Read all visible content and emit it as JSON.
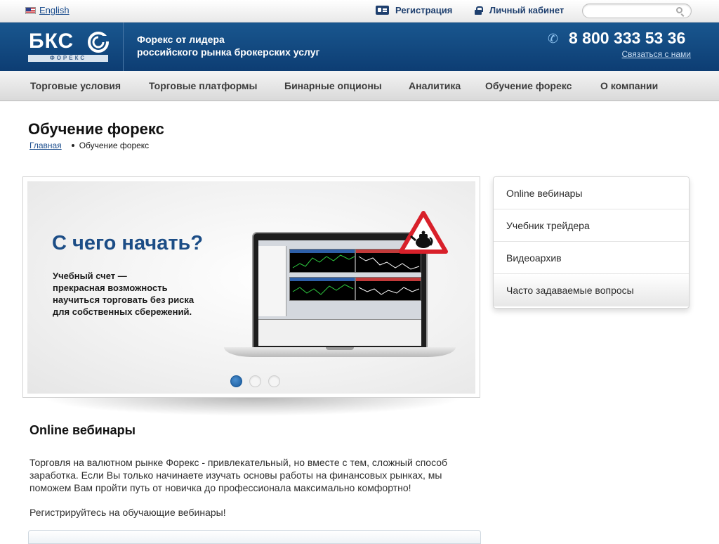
{
  "topbar": {
    "language": "English",
    "register": "Регистрация",
    "cabinet": "Личный кабинет",
    "search_placeholder": ""
  },
  "header": {
    "logo_text": "БКС",
    "logo_sub": "ФОРЕКС",
    "tagline_line1": "Форекс от лидера",
    "tagline_line2": "российского рынка брокерских услуг",
    "phone": "8 800 333 53 36",
    "contact": "Связаться с нами",
    "brand_color": "#0f4179"
  },
  "nav": {
    "items": [
      "Торговые условия",
      "Торговые платформы",
      "Бинарные опционы",
      "Аналитика",
      "Обучение форекс",
      "О компании"
    ]
  },
  "page": {
    "title": "Обучение форекс",
    "breadcrumb_home": "Главная",
    "breadcrumb_current": "Обучение форекс"
  },
  "banner": {
    "title": "С чего начать?",
    "text_line1": "Учебный счет —",
    "text_line2": "прекрасная возможность",
    "text_line3": "научиться торговать без риска",
    "text_line4": "для собственных сбережений.",
    "slides": 3,
    "active_slide": 1
  },
  "side_menu": {
    "items": [
      "Online вебинары",
      "Учебник трейдера",
      "Видеоархив",
      "Часто задаваемые вопросы"
    ]
  },
  "content": {
    "section_title": "Online вебинары",
    "paragraph": "Торговля на валютном рынке Форекс - привлекательный, но вместе с тем, сложный способ заработка. Если Вы только начинаете изучать основы работы на финансовых рынках, мы поможем Вам пройти путь от новичка до профессионала максимально комфортно!",
    "paragraph2": "Регистрируйтесь на обучающие вебинары!"
  }
}
